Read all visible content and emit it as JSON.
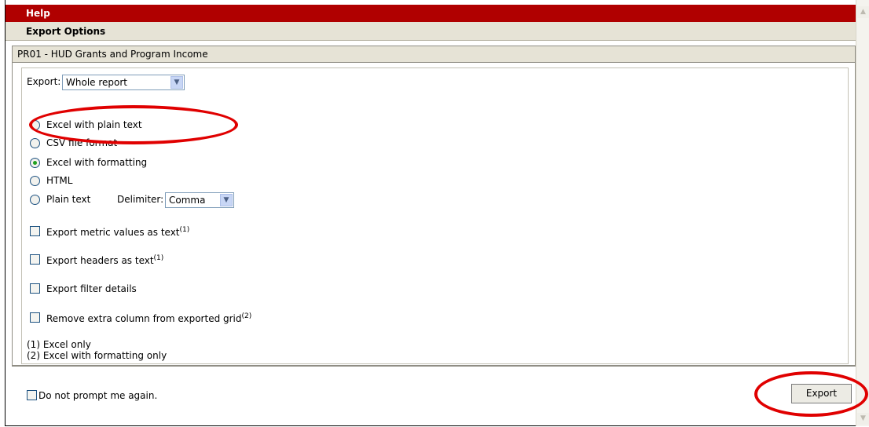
{
  "window": {
    "title": "Help",
    "subtitle": "Export Options"
  },
  "report": {
    "name": "PR01 - HUD Grants and Program Income"
  },
  "export_select": {
    "label": "Export:",
    "value": "Whole report"
  },
  "formats": [
    {
      "label": "Excel with plain text",
      "checked": false
    },
    {
      "label": "CSV file format",
      "checked": false
    },
    {
      "label": "Excel with formatting",
      "checked": true
    },
    {
      "label": "HTML",
      "checked": false
    },
    {
      "label": "Plain text",
      "checked": false
    }
  ],
  "delimiter": {
    "label": "Delimiter:",
    "value": "Comma"
  },
  "checkboxes": [
    {
      "label": "Export metric values as text",
      "note": "(1)",
      "checked": false
    },
    {
      "label": "Export headers as text",
      "note": "(1)",
      "checked": false
    },
    {
      "label": "Export filter details",
      "note": "",
      "checked": false
    },
    {
      "label": "Remove extra column from exported grid",
      "note": "(2)",
      "checked": false
    }
  ],
  "footnotes": [
    "(1) Excel only",
    "(2) Excel with formatting only"
  ],
  "prompt": {
    "label": "Do not prompt me again.",
    "checked": false
  },
  "actions": {
    "export_label": "Export"
  },
  "annotation_color": "#e00000"
}
